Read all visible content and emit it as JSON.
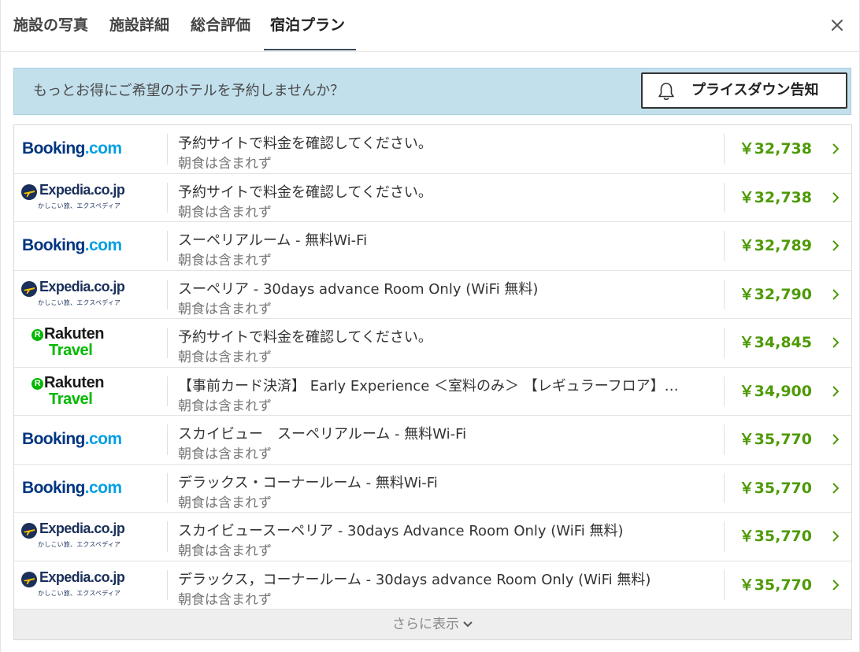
{
  "tabs": [
    {
      "label": "施設の写真",
      "active": false
    },
    {
      "label": "施設詳細",
      "active": false
    },
    {
      "label": "総合評価",
      "active": false
    },
    {
      "label": "宿泊プラン",
      "active": true
    }
  ],
  "banner": {
    "text": "もっとお得にご希望のホテルを予約しませんか？",
    "button_label": "プライスダウン告知"
  },
  "logos": {
    "booking": {
      "main": "Booking",
      "dotcom": ".com"
    },
    "expedia": {
      "main": "Expedia.co.jp",
      "sub": "かしこい旅、エクスペディア"
    },
    "rakuten": {
      "mark": "R",
      "top": "Rakuten",
      "bottom": "Travel"
    }
  },
  "plans": [
    {
      "provider": "booking",
      "name": "予約サイトで料金を確認してください。",
      "meal": "朝食は含まれず",
      "price": "￥32,738"
    },
    {
      "provider": "expedia",
      "name": "予約サイトで料金を確認してください。",
      "meal": "朝食は含まれず",
      "price": "￥32,738"
    },
    {
      "provider": "booking",
      "name": "スーペリアルーム - 無料Wi-Fi",
      "meal": "朝食は含まれず",
      "price": "￥32,789"
    },
    {
      "provider": "expedia",
      "name": "スーペリア - 30days advance Room Only (WiFi 無料)",
      "meal": "朝食は含まれず",
      "price": "￥32,790"
    },
    {
      "provider": "rakuten",
      "name": "予約サイトで料金を確認してください。",
      "meal": "朝食は含まれず",
      "price": "￥34,845"
    },
    {
      "provider": "rakuten",
      "name": "【事前カード決済】 Early Experience ＜室料のみ＞ 【レギュラーフロア】…",
      "meal": "朝食は含まれず",
      "price": "￥34,900"
    },
    {
      "provider": "booking",
      "name": "スカイビュー　スーペリアルーム - 無料Wi-Fi",
      "meal": "朝食は含まれず",
      "price": "￥35,770"
    },
    {
      "provider": "booking",
      "name": "デラックス・コーナールーム - 無料Wi-Fi",
      "meal": "朝食は含まれず",
      "price": "￥35,770"
    },
    {
      "provider": "expedia",
      "name": "スカイビュースーペリア - 30days Advance Room Only (WiFi 無料)",
      "meal": "朝食は含まれず",
      "price": "￥35,770"
    },
    {
      "provider": "expedia",
      "name": "デラックス，コーナールーム - 30days advance Room Only (WiFi 無料)",
      "meal": "朝食は含まれず",
      "price": "￥35,770"
    }
  ],
  "more_label": "さらに表示",
  "colors": {
    "price": "#4e9a06",
    "banner_bg": "#c2e0ec",
    "booking_blue": "#003580",
    "booking_light": "#009fe3",
    "rakuten_green": "#00b900"
  },
  "icons": {
    "close": "close-icon",
    "bell": "bell-icon",
    "row_chevron": "chevron-right-icon",
    "more_chevron": "chevron-down-icon"
  }
}
